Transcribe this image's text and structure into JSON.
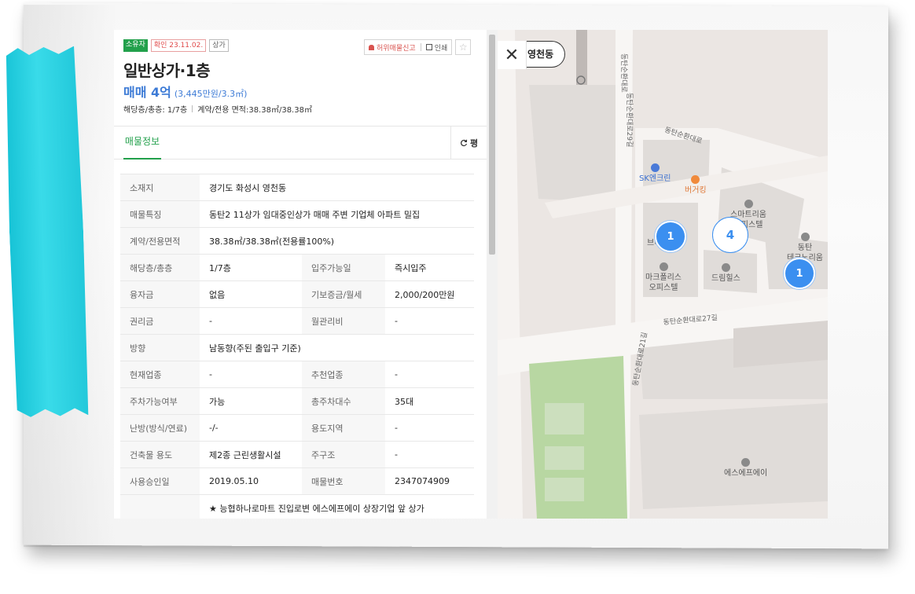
{
  "header": {
    "badges": {
      "owner": "소유자",
      "verified": "확인 23.11.02.",
      "type": "상가"
    },
    "actions": {
      "report": "허위매물신고",
      "print": "인쇄",
      "star": "☆"
    },
    "title": "일반상가·1층",
    "price": {
      "main": "매매 4억",
      "sub": "(3,445만원/3.3㎡)"
    },
    "meta": {
      "floor": "해당층/총층: 1/7층",
      "area": "계약/전용 면적:38.38㎡/38.38㎡"
    }
  },
  "tabs": {
    "active": "매물정보",
    "right_label": "평"
  },
  "info_rows": [
    {
      "label": "소재지",
      "value": "경기도 화성시 영천동"
    },
    {
      "label": "매물특징",
      "value": "동탄2 11상가 임대중인상가 매매 주변 기업체 아파트 밀집"
    },
    {
      "label": "계약/전용면적",
      "value": "38.38㎡/38.38㎡(전용률100%)"
    },
    {
      "label": "해당층/총층",
      "value": "1/7층",
      "label2": "입주가능일",
      "value2": "즉시입주"
    },
    {
      "label": "융자금",
      "value": "없음",
      "label2": "기보증금/월세",
      "value2": "2,000/200만원"
    },
    {
      "label": "권리금",
      "value": "-",
      "label2": "월관리비",
      "value2": "-"
    },
    {
      "label": "방향",
      "value": "남동향(주된 출입구 기준)"
    },
    {
      "label": "현재업종",
      "value": "-",
      "label2": "추천업종",
      "value2": "-"
    },
    {
      "label": "주차가능여부",
      "value": "가능",
      "label2": "총주차대수",
      "value2": "35대"
    },
    {
      "label": "난방(방식/연료)",
      "value": "-/-",
      "label2": "용도지역",
      "value2": "-"
    },
    {
      "label": "건축물 용도",
      "value": "제2종 근린생활시설",
      "label2": "주구조",
      "value2": "-"
    },
    {
      "label": "사용승인일",
      "value": "2019.05.10",
      "label2": "매물번호",
      "value2": "2347074909"
    },
    {
      "label": "",
      "value": "★ 능협하나로마트 진입로변 에스에프에이 상장기업 앞 상가"
    }
  ],
  "map": {
    "close": "✕",
    "location": "영천동",
    "clusters": [
      {
        "count": "1",
        "style": "blue"
      },
      {
        "count": "4",
        "style": "white"
      },
      {
        "count": "1",
        "style": "blue"
      }
    ],
    "pois": {
      "sk": "SK엔크린",
      "burger": "버거킹",
      "smart1": "스마트리움",
      "smart2": "오피스텔",
      "dongtan1": "동탄",
      "dongtan2": "테크노리움",
      "brick": "브리즈힐",
      "mark1": "마크폴리스",
      "mark2": "오피스텔",
      "dream": "드림힐스",
      "sfa": "에스에프에이"
    },
    "roads": {
      "r1": "동탄순환대로",
      "r2": "동탄순환대로29길",
      "r3": "동탄순환대로27길",
      "r4": "동탄순환대로21길",
      "r5": "동탄순환대로"
    }
  }
}
